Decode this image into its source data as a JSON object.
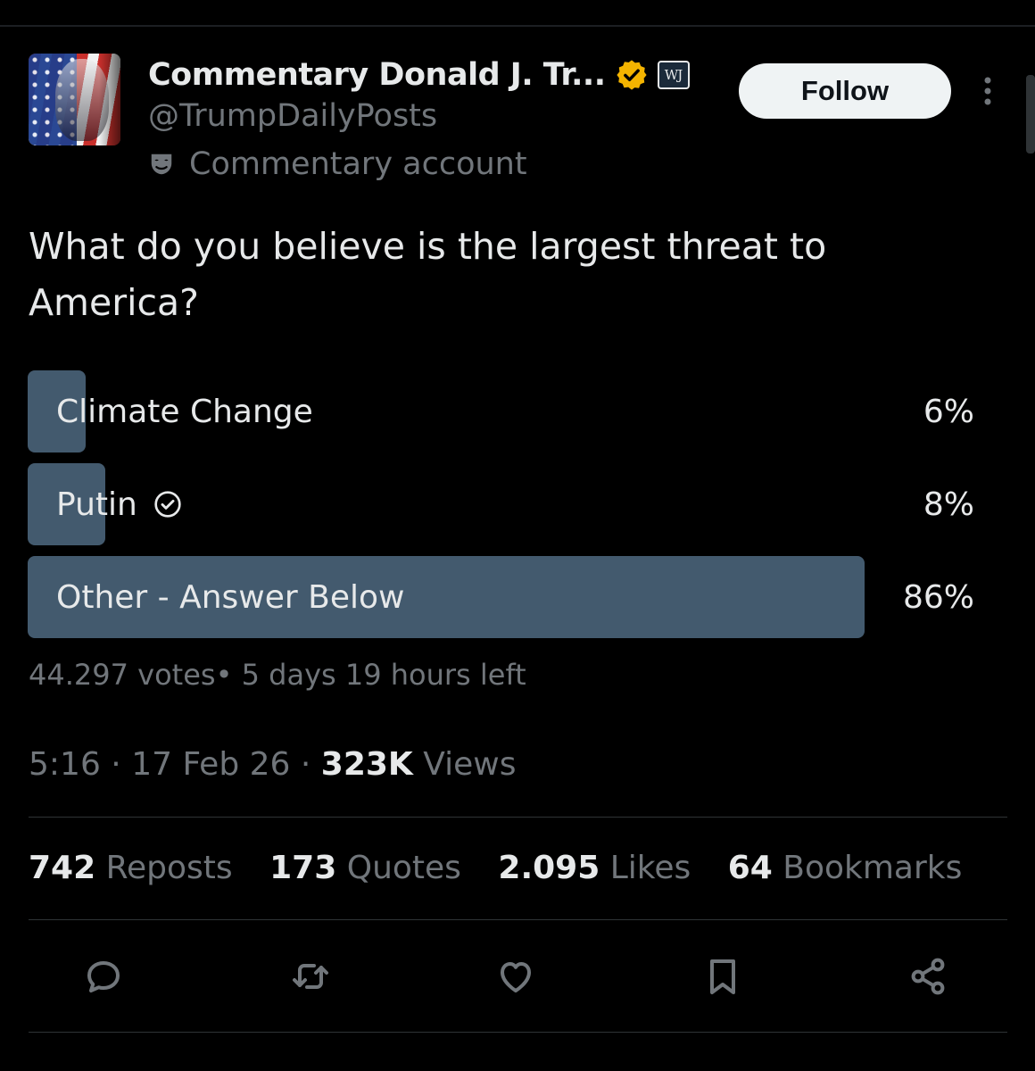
{
  "author": {
    "display_name": "Commentary Donald J. Tr...",
    "handle": "@TrumpDailyPosts",
    "affiliate_badge": "WJ",
    "account_label": "Commentary account",
    "verified_badge_color": "#f4b400"
  },
  "header": {
    "follow_label": "Follow"
  },
  "post": {
    "question": "What do you believe is the largest threat to America?"
  },
  "poll": {
    "options": [
      {
        "label": "Climate Change",
        "percent_text": "6%",
        "share": 0.06,
        "selected": false
      },
      {
        "label": "Putin",
        "percent_text": "8%",
        "share": 0.08,
        "selected": true
      },
      {
        "label": "Other - Answer Below",
        "percent_text": "86%",
        "share": 0.86,
        "selected": false
      }
    ],
    "meta": "44.297 votes• 5 days 19 hours left",
    "bar_color": "#435a6e"
  },
  "timestamp": {
    "time": "5:16",
    "date": "17 Feb 26",
    "views_count": "323K",
    "views_label": "Views"
  },
  "stats": [
    {
      "count": "742",
      "label": "Reposts"
    },
    {
      "count": "173",
      "label": "Quotes"
    },
    {
      "count": "2.095",
      "label": "Likes"
    },
    {
      "count": "64",
      "label": "Bookmarks"
    }
  ],
  "actions": [
    "reply-icon",
    "repost-icon",
    "like-icon",
    "bookmark-icon",
    "share-icon"
  ],
  "colors": {
    "background": "#000000",
    "text": "#e7e9ea",
    "muted": "#71767b"
  }
}
